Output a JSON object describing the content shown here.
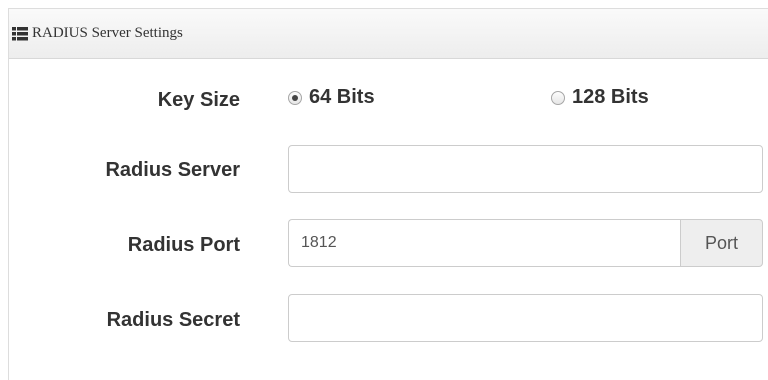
{
  "panel": {
    "title": "RADIUS Server Settings",
    "icon": "list-icon"
  },
  "key_size": {
    "label": "Key Size",
    "options": [
      {
        "label": "64 Bits",
        "checked": true
      },
      {
        "label": "128 Bits",
        "checked": false
      }
    ]
  },
  "radius_server": {
    "label": "Radius Server",
    "value": "",
    "placeholder": ""
  },
  "radius_port": {
    "label": "Radius Port",
    "value": "1812",
    "addon": "Port"
  },
  "radius_secret": {
    "label": "Radius Secret",
    "value": "",
    "placeholder": ""
  }
}
